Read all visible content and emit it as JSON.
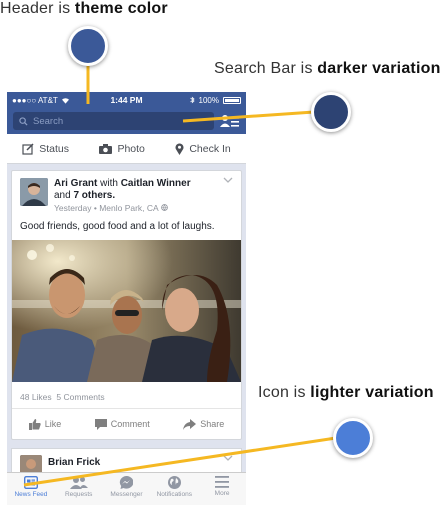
{
  "annotations": [
    {
      "prefix": "Header is ",
      "bold": "theme color",
      "color": "#3b5998"
    },
    {
      "prefix": "Search Bar is ",
      "bold": "darker variation",
      "color": "#2d4373"
    },
    {
      "prefix": "Icon is ",
      "bold": "lighter variation",
      "color": "#4c7ed7"
    }
  ],
  "status": {
    "carrier": "●●●○○ AT&T",
    "time": "1:44 PM",
    "battery": "100%"
  },
  "search": {
    "placeholder": "Search"
  },
  "composer": {
    "status": "Status",
    "photo": "Photo",
    "checkin": "Check In"
  },
  "post": {
    "author": "Ari Grant",
    "with_word": " with ",
    "tagged": "Caitlan Winner",
    "and_word": "and ",
    "others": "7 others.",
    "meta": "Yesterday • Menlo Park, CA",
    "text": "Good friends, good food and a lot of laughs.",
    "likes": "48 Likes",
    "comments": "5 Comments",
    "like_label": "Like",
    "comment_label": "Comment",
    "share_label": "Share"
  },
  "next_post": {
    "author": "Brian Frick"
  },
  "tabs": [
    {
      "label": "News Feed",
      "icon": "news-feed-icon"
    },
    {
      "label": "Requests",
      "icon": "requests-icon"
    },
    {
      "label": "Messenger",
      "icon": "messenger-icon"
    },
    {
      "label": "Notifications",
      "icon": "globe-icon"
    },
    {
      "label": "More",
      "icon": "menu-icon"
    }
  ],
  "colors": {
    "theme": "#3b5998",
    "dark": "#2d4373",
    "light": "#4c7ed7",
    "line": "#f5b822"
  }
}
